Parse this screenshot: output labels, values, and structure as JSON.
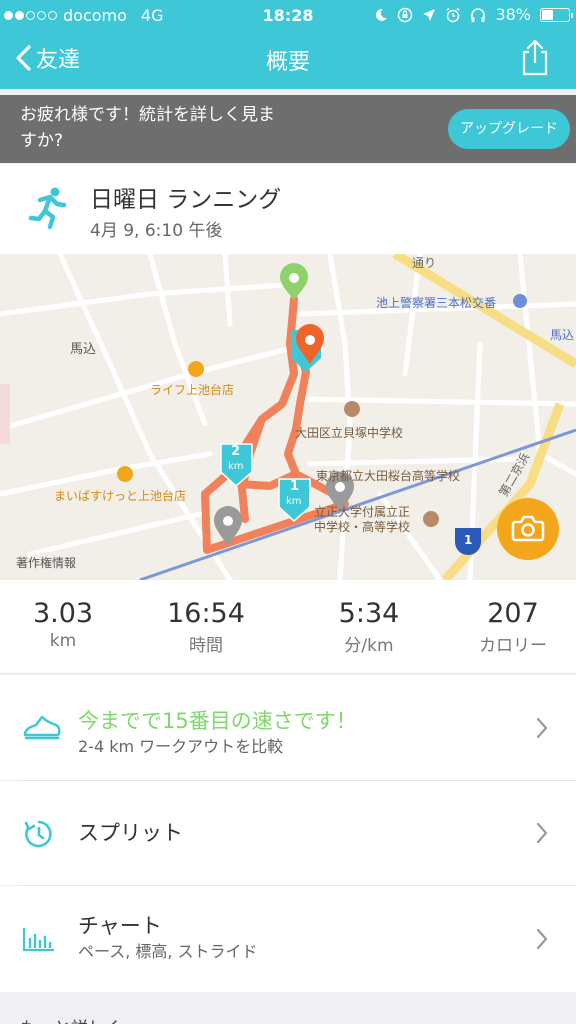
{
  "status": {
    "carrier": "docomo",
    "network": "4G",
    "time": "18:28",
    "battery": "38%",
    "battery_level": 0.38
  },
  "nav": {
    "back_label": "友達",
    "title": "概要"
  },
  "banner": {
    "message": "お疲れ様です！統計を詳しく見ますか?",
    "button_label": "アップグレード"
  },
  "activity": {
    "name": "日曜日 ランニング",
    "date": "4月 9, 6:10 午後"
  },
  "map": {
    "labels": {
      "umagome": "馬込",
      "police": "池上警察署三本松交番",
      "umagome_right": "馬込",
      "life": "ライフ上池台店",
      "maibasuket": "まいばすけっと上池台店",
      "school1": "大田区立貝塚中学校",
      "school2": "東京都立大田桜台高等学校",
      "school3a": "立正大学付属立正",
      "school3b": "中学校・高等学校",
      "copyright": "著作権情報",
      "street": "通り",
      "route_name": "第二京浜",
      "route_number": "1",
      "km1": "1",
      "km2": "2",
      "km_unit": "km"
    }
  },
  "stats": [
    {
      "value": "3.03",
      "unit": "km"
    },
    {
      "value": "16:54",
      "unit": "時間"
    },
    {
      "value": "5:34",
      "unit": "分/km"
    },
    {
      "value": "207",
      "unit": "カロリー"
    }
  ],
  "rows": {
    "achievement": {
      "title": "今までで15番目の速さです！",
      "subtitle": "2-4 km ワークアウトを比較",
      "title_color": "#7dd96b"
    },
    "splits": {
      "title": "スプリット"
    },
    "chart": {
      "title": "チャート",
      "subtitle": "ペース, 標高, ストライド"
    }
  },
  "bottom": {
    "text": "もっと詳しく"
  },
  "colors": {
    "accent": "#3ec7d6",
    "route": "#f0774d",
    "camera": "#f3a61b",
    "banner": "#6e6e6e"
  }
}
